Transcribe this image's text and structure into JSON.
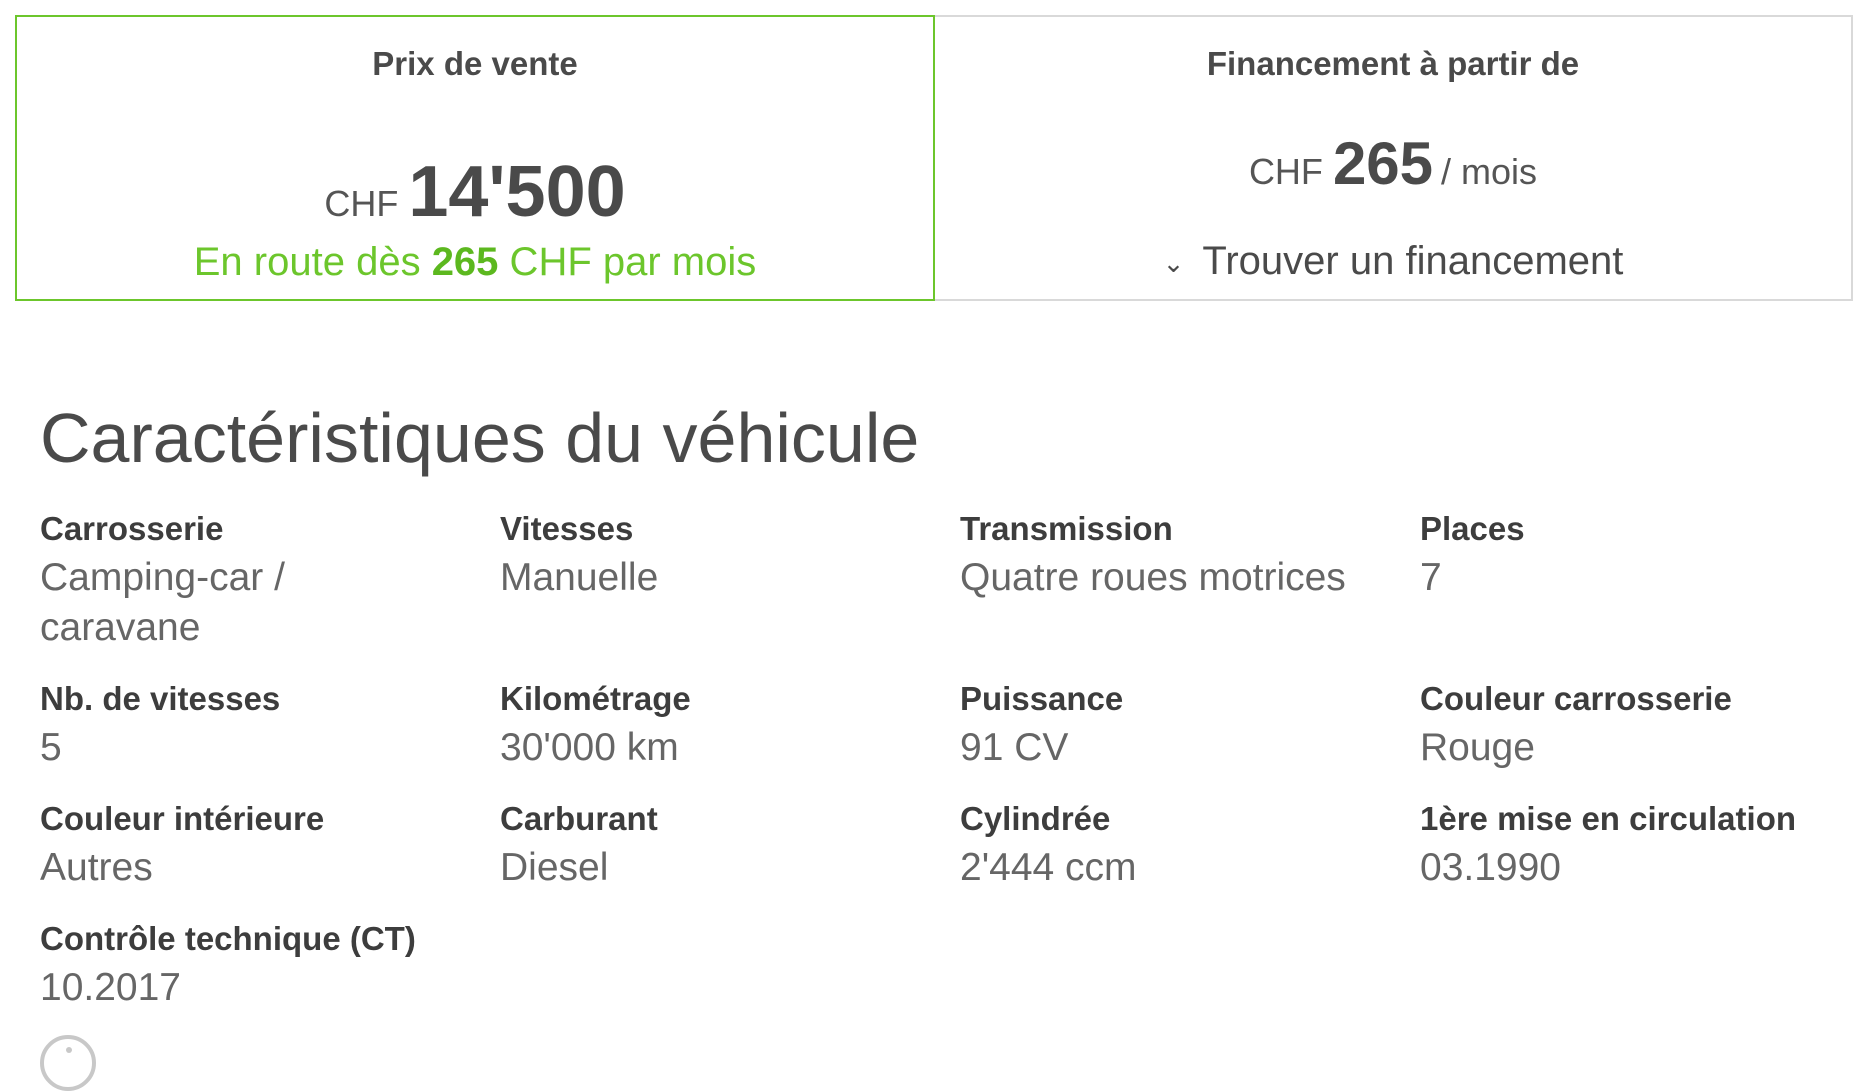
{
  "price_box": {
    "title": "Prix de vente",
    "currency": "CHF",
    "price": "14'500",
    "monthly_prefix": "En route dès ",
    "monthly_amount": "265",
    "monthly_suffix": " CHF par mois",
    "accent_color": "#6cc62c"
  },
  "finance_box": {
    "title": "Financement à partir de",
    "currency": "CHF",
    "amount": "265",
    "per": "/ mois",
    "link_icon": "chevron-down-icon",
    "link_label": "Trouver un financement"
  },
  "specs": {
    "title": "Caractéristiques du véhicule",
    "items": [
      {
        "label": "Carrosserie",
        "value": "Camping-car / caravane"
      },
      {
        "label": "Vitesses",
        "value": "Manuelle"
      },
      {
        "label": "Transmission",
        "value": "Quatre roues motrices"
      },
      {
        "label": "Places",
        "value": "7"
      },
      {
        "label": "Nb. de vitesses",
        "value": "5"
      },
      {
        "label": "Kilométrage",
        "value": "30'000 km"
      },
      {
        "label": "Puissance",
        "value": "91 CV"
      },
      {
        "label": "Couleur carrosserie",
        "value": "Rouge"
      },
      {
        "label": "Couleur intérieure",
        "value": "Autres"
      },
      {
        "label": "Carburant",
        "value": "Diesel"
      },
      {
        "label": "Cylindrée",
        "value": "2'444 ccm"
      },
      {
        "label": "1ère mise en circulation",
        "value": "03.1990"
      },
      {
        "label": "Contrôle technique (CT)",
        "value": "10.2017"
      }
    ],
    "info_icon": "info-icon"
  }
}
